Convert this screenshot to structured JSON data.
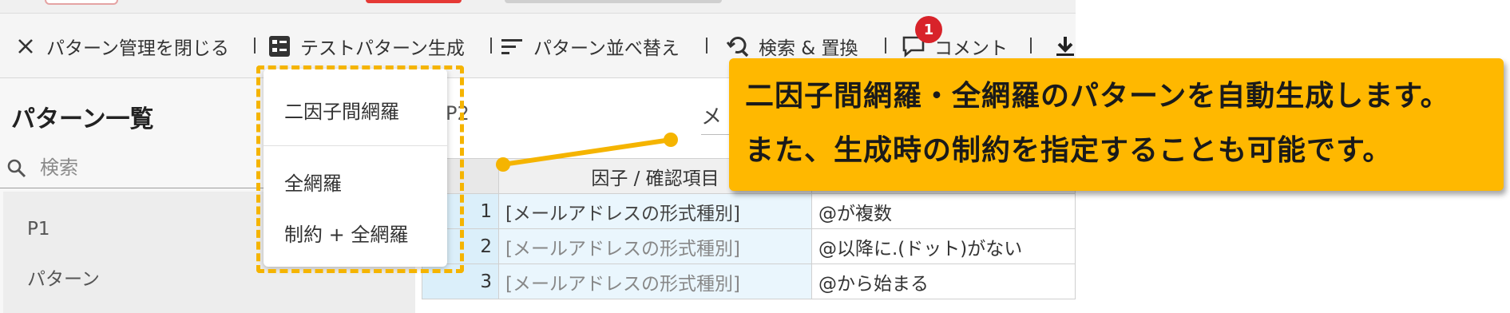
{
  "toolbar": {
    "close_label": "パターン管理を閉じる",
    "generate_label": "テストパターン生成",
    "sort_label": "パターン並べ替え",
    "search_replace_label": "検索 & 置換",
    "comment_label": "コメント",
    "comment_badge": "1"
  },
  "sidebar": {
    "title": "パターン一覧",
    "search_placeholder": "検索",
    "items": [
      {
        "label": "P1"
      },
      {
        "label": "パターン"
      }
    ]
  },
  "main": {
    "tab_partial": "P2",
    "header_partial": "メ"
  },
  "dropdown": {
    "items": [
      {
        "label": "二因子間網羅"
      },
      {
        "label": "全網羅"
      },
      {
        "label": "制約 + 全網羅"
      }
    ]
  },
  "grid": {
    "header_factor": "因子 / 確認項目",
    "rows": [
      {
        "num": "1",
        "factor": "[メールアドレスの形式種別]",
        "value": "@が複数"
      },
      {
        "num": "2",
        "factor": "[メールアドレスの形式種別]",
        "value": "@以降に.(ドット)がない"
      },
      {
        "num": "3",
        "factor": "[メールアドレスの形式種別]",
        "value": "@から始まる"
      }
    ]
  },
  "callout": {
    "line1": "二因子間網羅・全網羅のパターンを自動生成します。",
    "line2": "また、生成時の制約を指定することも可能です。"
  },
  "colors": {
    "accent": "#ffb800",
    "highlight_border": "#f5b400",
    "badge": "#d8232a",
    "grid_row_number": "#dbeffa"
  }
}
